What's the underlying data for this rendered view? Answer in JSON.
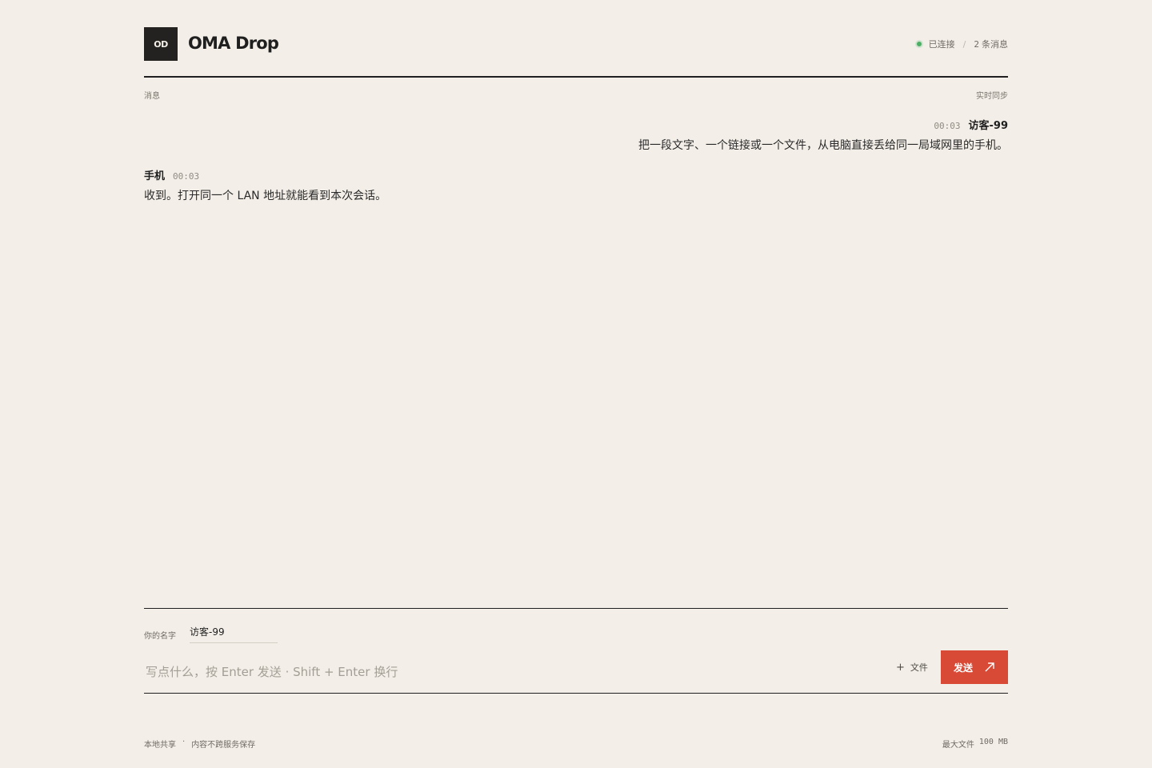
{
  "header": {
    "logo_text": "OD",
    "app_title": "OMA Drop",
    "status_label": "已连接",
    "status_separator": "/",
    "message_count": "2",
    "message_count_label": "条消息",
    "status_color": "#4caf64"
  },
  "section": {
    "left_label": "消息",
    "right_label": "实时同步"
  },
  "messages": [
    {
      "time": "00:03",
      "sender": "访客-99",
      "text": "把一段文字、一个链接或一个文件，从电脑直接丢给同一局域网里的手机。"
    },
    {
      "time": "00:03",
      "sender": "手机",
      "text": "收到。打开同一个 LAN 地址就能看到本次会话。"
    }
  ],
  "composer": {
    "name_label": "你的名字",
    "name_value": "访客-99",
    "message_placeholder": "写点什么，按 Enter 发送 · Shift + Enter 换行",
    "file_button_label": "文件",
    "file_icon": "plus-icon",
    "send_button_label": "发送",
    "send_icon": "arrow-up-right-icon",
    "send_color": "#d94a36"
  },
  "footer": {
    "left_primary": "本地共享",
    "left_separator": "·",
    "left_secondary": "内容不跨服务保存",
    "right_label": "最大文件",
    "right_value": "100 MB"
  }
}
